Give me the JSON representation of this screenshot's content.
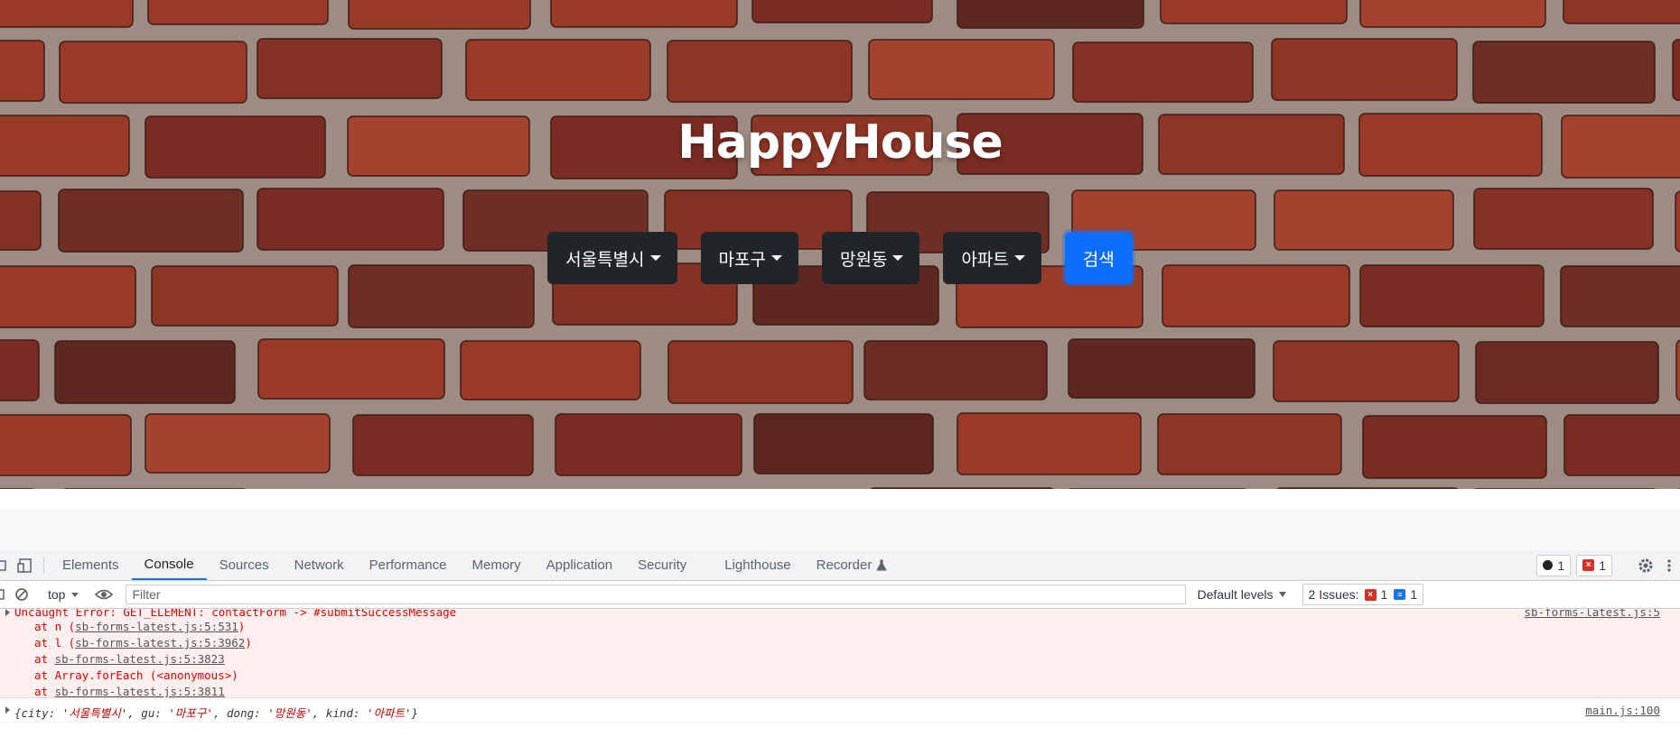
{
  "hero": {
    "title": "HappyHouse",
    "dropdowns": [
      {
        "label": "서울특별시"
      },
      {
        "label": "마포구"
      },
      {
        "label": "망원동"
      },
      {
        "label": "아파트"
      }
    ],
    "search_label": "검색"
  },
  "devtools": {
    "tabs": [
      {
        "label": "Elements"
      },
      {
        "label": "Console"
      },
      {
        "label": "Sources"
      },
      {
        "label": "Network"
      },
      {
        "label": "Performance"
      },
      {
        "label": "Memory"
      },
      {
        "label": "Application"
      },
      {
        "label": "Security"
      },
      {
        "label": "Lighthouse"
      },
      {
        "label": "Recorder"
      }
    ],
    "active_tab": "Console",
    "counts": {
      "messages": "1",
      "errors": "1"
    },
    "toolbar": {
      "context": "top",
      "filter_placeholder": "Filter",
      "levels": "Default levels",
      "issues_label": "2 Issues:",
      "issues_errors": "1",
      "issues_info": "1"
    },
    "error": {
      "message": "Uncaught Error: GET_ELEMENT: contactForm -> #submitSuccessMessage",
      "source": "sb-forms-latest.js:5",
      "stack": [
        {
          "prefix": "at n (",
          "link": "sb-forms-latest.js:5:531",
          "suffix": ")"
        },
        {
          "prefix": "at l (",
          "link": "sb-forms-latest.js:5:3962",
          "suffix": ")"
        },
        {
          "prefix": "at ",
          "link": "sb-forms-latest.js:5:3823",
          "suffix": ""
        },
        {
          "prefix": "at Array.forEach (<anonymous>)",
          "link": "",
          "suffix": ""
        },
        {
          "prefix": "at ",
          "link": "sb-forms-latest.js:5:3811",
          "suffix": ""
        }
      ]
    },
    "log": {
      "source": "main.js:100",
      "object": {
        "open": "{",
        "k1": "city: ",
        "v1": "'서울특별시'",
        "k2": ", gu: ",
        "v2": "'마포구'",
        "k3": ", dong: ",
        "v3": "'망원동'",
        "k4": ", kind: ",
        "v4": "'아파트'",
        "close": "}"
      }
    }
  },
  "colors": {
    "search_button": "#0d6efd",
    "dropdown": "#212529",
    "error_bg": "#fff0f0",
    "error_text": "#e50000",
    "active_tab_underline": "#1a73e8"
  },
  "icons": [
    "device-toggle-icon",
    "clear-console-icon",
    "eye-icon",
    "settings-gear-icon",
    "kebab-menu-icon",
    "recorder-flask-icon"
  ]
}
